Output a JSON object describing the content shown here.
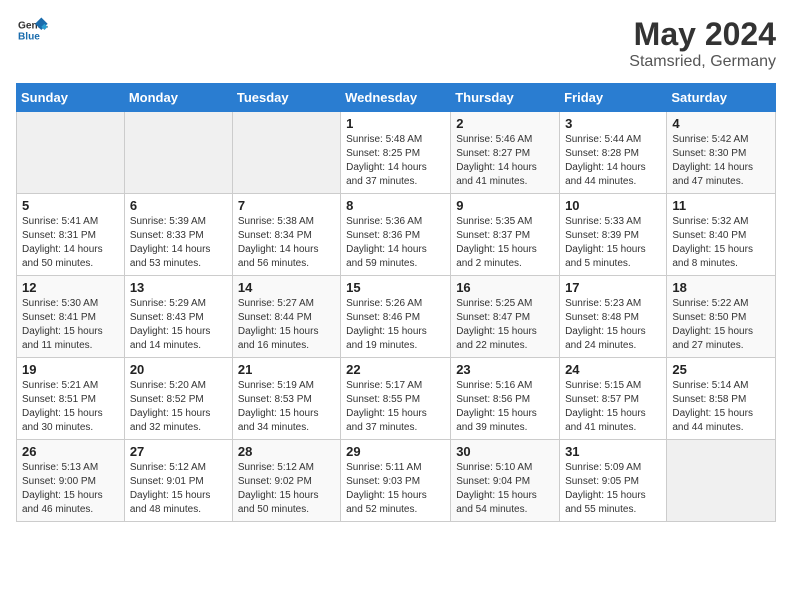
{
  "header": {
    "logo_general": "General",
    "logo_blue": "Blue",
    "month_year": "May 2024",
    "location": "Stamsried, Germany"
  },
  "weekdays": [
    "Sunday",
    "Monday",
    "Tuesday",
    "Wednesday",
    "Thursday",
    "Friday",
    "Saturday"
  ],
  "weeks": [
    [
      {
        "day": "",
        "empty": true
      },
      {
        "day": "",
        "empty": true
      },
      {
        "day": "",
        "empty": true
      },
      {
        "day": "1",
        "sunrise": "5:48 AM",
        "sunset": "8:25 PM",
        "daylight": "14 hours and 37 minutes."
      },
      {
        "day": "2",
        "sunrise": "5:46 AM",
        "sunset": "8:27 PM",
        "daylight": "14 hours and 41 minutes."
      },
      {
        "day": "3",
        "sunrise": "5:44 AM",
        "sunset": "8:28 PM",
        "daylight": "14 hours and 44 minutes."
      },
      {
        "day": "4",
        "sunrise": "5:42 AM",
        "sunset": "8:30 PM",
        "daylight": "14 hours and 47 minutes."
      }
    ],
    [
      {
        "day": "5",
        "sunrise": "5:41 AM",
        "sunset": "8:31 PM",
        "daylight": "14 hours and 50 minutes."
      },
      {
        "day": "6",
        "sunrise": "5:39 AM",
        "sunset": "8:33 PM",
        "daylight": "14 hours and 53 minutes."
      },
      {
        "day": "7",
        "sunrise": "5:38 AM",
        "sunset": "8:34 PM",
        "daylight": "14 hours and 56 minutes."
      },
      {
        "day": "8",
        "sunrise": "5:36 AM",
        "sunset": "8:36 PM",
        "daylight": "14 hours and 59 minutes."
      },
      {
        "day": "9",
        "sunrise": "5:35 AM",
        "sunset": "8:37 PM",
        "daylight": "15 hours and 2 minutes."
      },
      {
        "day": "10",
        "sunrise": "5:33 AM",
        "sunset": "8:39 PM",
        "daylight": "15 hours and 5 minutes."
      },
      {
        "day": "11",
        "sunrise": "5:32 AM",
        "sunset": "8:40 PM",
        "daylight": "15 hours and 8 minutes."
      }
    ],
    [
      {
        "day": "12",
        "sunrise": "5:30 AM",
        "sunset": "8:41 PM",
        "daylight": "15 hours and 11 minutes."
      },
      {
        "day": "13",
        "sunrise": "5:29 AM",
        "sunset": "8:43 PM",
        "daylight": "15 hours and 14 minutes."
      },
      {
        "day": "14",
        "sunrise": "5:27 AM",
        "sunset": "8:44 PM",
        "daylight": "15 hours and 16 minutes."
      },
      {
        "day": "15",
        "sunrise": "5:26 AM",
        "sunset": "8:46 PM",
        "daylight": "15 hours and 19 minutes."
      },
      {
        "day": "16",
        "sunrise": "5:25 AM",
        "sunset": "8:47 PM",
        "daylight": "15 hours and 22 minutes."
      },
      {
        "day": "17",
        "sunrise": "5:23 AM",
        "sunset": "8:48 PM",
        "daylight": "15 hours and 24 minutes."
      },
      {
        "day": "18",
        "sunrise": "5:22 AM",
        "sunset": "8:50 PM",
        "daylight": "15 hours and 27 minutes."
      }
    ],
    [
      {
        "day": "19",
        "sunrise": "5:21 AM",
        "sunset": "8:51 PM",
        "daylight": "15 hours and 30 minutes."
      },
      {
        "day": "20",
        "sunrise": "5:20 AM",
        "sunset": "8:52 PM",
        "daylight": "15 hours and 32 minutes."
      },
      {
        "day": "21",
        "sunrise": "5:19 AM",
        "sunset": "8:53 PM",
        "daylight": "15 hours and 34 minutes."
      },
      {
        "day": "22",
        "sunrise": "5:17 AM",
        "sunset": "8:55 PM",
        "daylight": "15 hours and 37 minutes."
      },
      {
        "day": "23",
        "sunrise": "5:16 AM",
        "sunset": "8:56 PM",
        "daylight": "15 hours and 39 minutes."
      },
      {
        "day": "24",
        "sunrise": "5:15 AM",
        "sunset": "8:57 PM",
        "daylight": "15 hours and 41 minutes."
      },
      {
        "day": "25",
        "sunrise": "5:14 AM",
        "sunset": "8:58 PM",
        "daylight": "15 hours and 44 minutes."
      }
    ],
    [
      {
        "day": "26",
        "sunrise": "5:13 AM",
        "sunset": "9:00 PM",
        "daylight": "15 hours and 46 minutes."
      },
      {
        "day": "27",
        "sunrise": "5:12 AM",
        "sunset": "9:01 PM",
        "daylight": "15 hours and 48 minutes."
      },
      {
        "day": "28",
        "sunrise": "5:12 AM",
        "sunset": "9:02 PM",
        "daylight": "15 hours and 50 minutes."
      },
      {
        "day": "29",
        "sunrise": "5:11 AM",
        "sunset": "9:03 PM",
        "daylight": "15 hours and 52 minutes."
      },
      {
        "day": "30",
        "sunrise": "5:10 AM",
        "sunset": "9:04 PM",
        "daylight": "15 hours and 54 minutes."
      },
      {
        "day": "31",
        "sunrise": "5:09 AM",
        "sunset": "9:05 PM",
        "daylight": "15 hours and 55 minutes."
      },
      {
        "day": "",
        "empty": true
      }
    ]
  ]
}
